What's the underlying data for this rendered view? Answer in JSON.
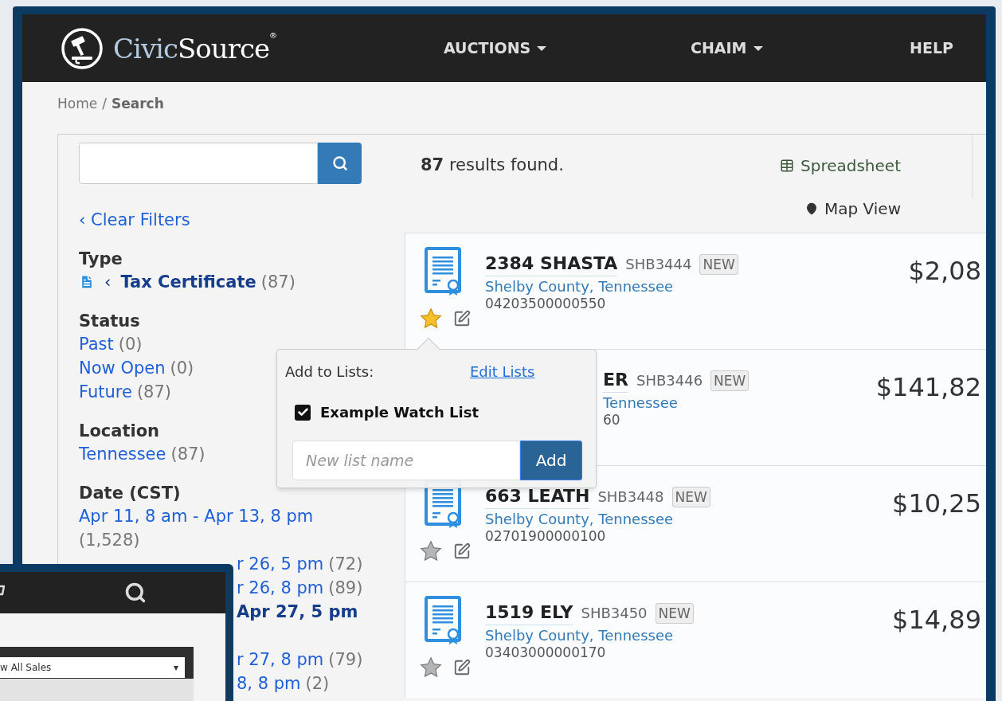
{
  "logo": {
    "parts": [
      "Civic",
      "Source"
    ],
    "mark": "®"
  },
  "nav": [
    {
      "label": "AUCTIONS",
      "dropdown": true
    },
    {
      "label": "CHAIM",
      "dropdown": true
    },
    {
      "label": "HELP",
      "dropdown": false
    }
  ],
  "breadcrumb": {
    "items": [
      {
        "label": "Home",
        "current": false
      },
      {
        "label": "Search",
        "current": true
      }
    ],
    "separator": "/"
  },
  "clear_filters": "‹ Clear Filters",
  "filters": [
    {
      "heading": "Type",
      "options": [
        {
          "prefix": "‹",
          "label": "Tax Certificate",
          "count": "(87)",
          "selected": true
        }
      ]
    },
    {
      "heading": "Status",
      "options": [
        {
          "label": "Past",
          "count": "(0)",
          "selected": false
        },
        {
          "label": "Now Open",
          "count": "(0)",
          "selected": false
        },
        {
          "label": "Future",
          "count": "(87)",
          "selected": false
        }
      ]
    },
    {
      "heading": "Location",
      "options": [
        {
          "label": "Tennessee",
          "count": "(87)",
          "selected": false
        }
      ]
    },
    {
      "heading": "Date (CST)",
      "options": [
        {
          "label": "Apr 11, 8 am - Apr 13, 8 pm",
          "count": "(1,528)",
          "selected": false
        }
      ],
      "covered_options": [
        {
          "label": "r 26, 5 pm",
          "count": "(72)",
          "selected": false
        },
        {
          "label": "r 26, 8 pm",
          "count": "(89)",
          "selected": false
        },
        {
          "label": "Apr 27, 5 pm",
          "selected": true
        },
        {
          "label": "r 27, 8 pm",
          "count": "(79)",
          "selected": false
        },
        {
          "label": "8, 8 pm",
          "count": "(2)",
          "selected": false
        }
      ]
    }
  ],
  "results": "**87** results found.",
  "views": [
    {
      "kind": "spreadsheet",
      "label": "Spreadsheet"
    },
    {
      "kind": "map",
      "label": "Map View"
    }
  ],
  "listings": [
    {
      "title": "2384 SHASTA",
      "code": "SHB3444",
      "badge": "NEW",
      "location": "Shelby County, Tennessee",
      "parcel": "04203500000550",
      "price": "$2,08",
      "starred": true,
      "covered": false
    },
    {
      "title": "ER",
      "code": "SHB3446",
      "badge": "NEW",
      "location": "Tennessee",
      "parcel": "60",
      "price": "$141,82",
      "covered": true
    },
    {
      "title": "663 LEATH",
      "code": "SHB3448",
      "badge": "NEW",
      "location": "Shelby County, Tennessee",
      "parcel": "02701900000100",
      "price": "$10,25",
      "starred": false,
      "covered": false
    },
    {
      "title": "1519 ELY",
      "code": "SHB3450",
      "badge": "NEW",
      "location": "Shelby County, Tennessee",
      "parcel": "03403000000170",
      "price": "$14,89",
      "starred": false,
      "covered": false
    }
  ],
  "popover": {
    "title": "Add to Lists:",
    "edit_link": "Edit Lists",
    "lists": [
      {
        "label": "Example Watch List",
        "checked": true
      }
    ],
    "input": {
      "placeholder": "New list name"
    },
    "button": "Add"
  },
  "overlay_window": {
    "select": {
      "value": "w All Sales",
      "caret": "▾"
    }
  }
}
